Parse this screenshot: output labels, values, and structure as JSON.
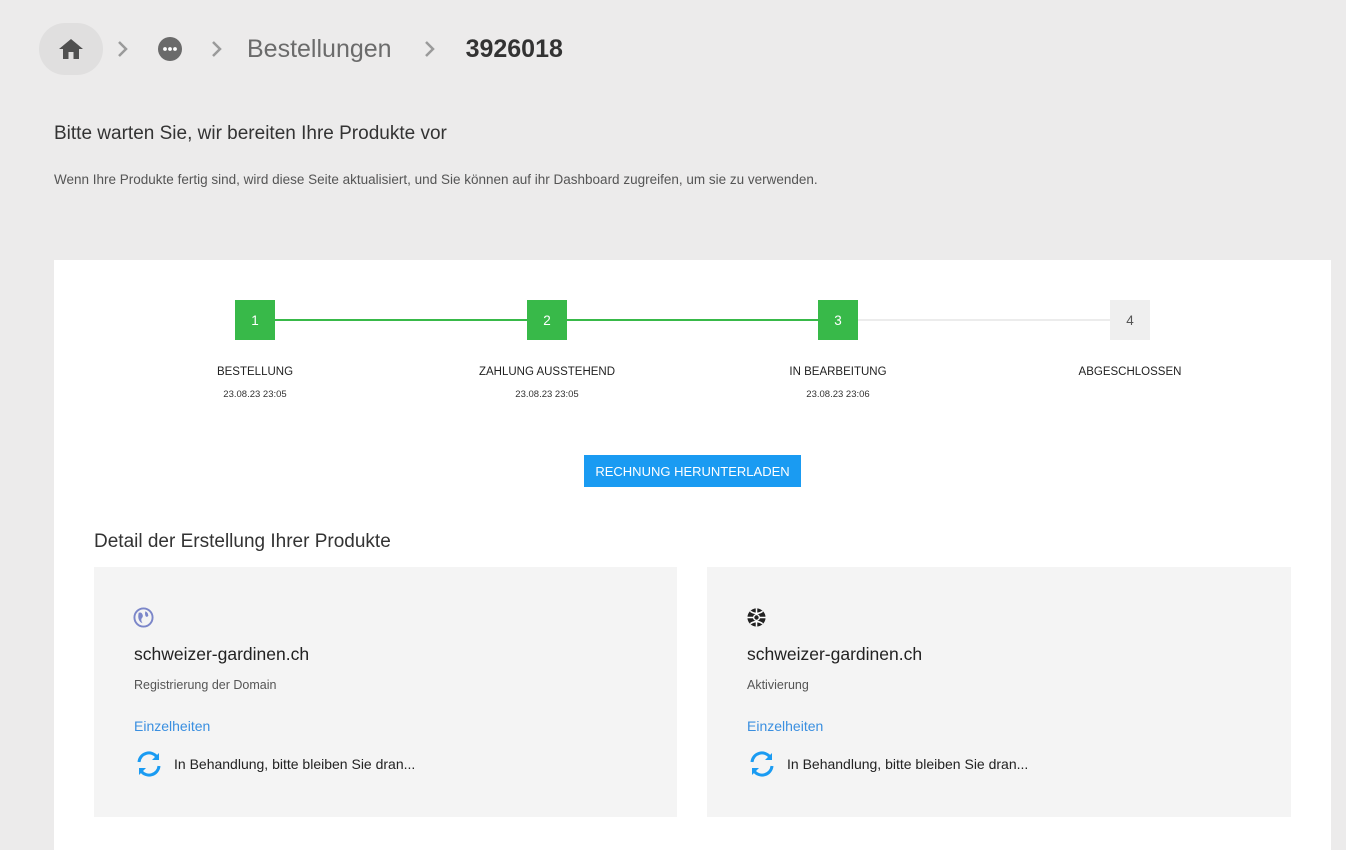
{
  "breadcrumb": {
    "section": "Bestellungen",
    "current": "3926018"
  },
  "header": {
    "title": "Bitte warten Sie, wir bereiten Ihre Produkte vor",
    "subtitle": "Wenn Ihre Produkte fertig sind, wird diese Seite aktualisiert, und Sie können auf ihr Dashboard zugreifen, um sie zu verwenden."
  },
  "steps": [
    {
      "number": "1",
      "label": "BESTELLUNG",
      "date": "23.08.23 23:05",
      "done": true
    },
    {
      "number": "2",
      "label": "ZAHLUNG AUSSTEHEND",
      "date": "23.08.23 23:05",
      "done": true
    },
    {
      "number": "3",
      "label": "IN BEARBEITUNG",
      "date": "23.08.23 23:06",
      "done": true
    },
    {
      "number": "4",
      "label": "ABGESCHLOSSEN",
      "date": "",
      "done": false
    }
  ],
  "invoice_button": "RECHNUNG HERUNTERLADEN",
  "section_title": "Detail der Erstellung Ihrer Produkte",
  "products": [
    {
      "icon": "globe-icon",
      "name": "schweizer-gardinen.ch",
      "type": "Registrierung der Domain",
      "link": "Einzelheiten",
      "status": "In Behandlung, bitte bleiben Sie dran..."
    },
    {
      "icon": "web-activation-icon",
      "name": "schweizer-gardinen.ch",
      "type": "Aktivierung",
      "link": "Einzelheiten",
      "status": "In Behandlung, bitte bleiben Sie dran..."
    }
  ],
  "colors": {
    "done": "#38b949",
    "todo": "#efefef",
    "button": "#1a9bf2",
    "link": "#3a8fe0",
    "sync": "#1a9bf2"
  }
}
